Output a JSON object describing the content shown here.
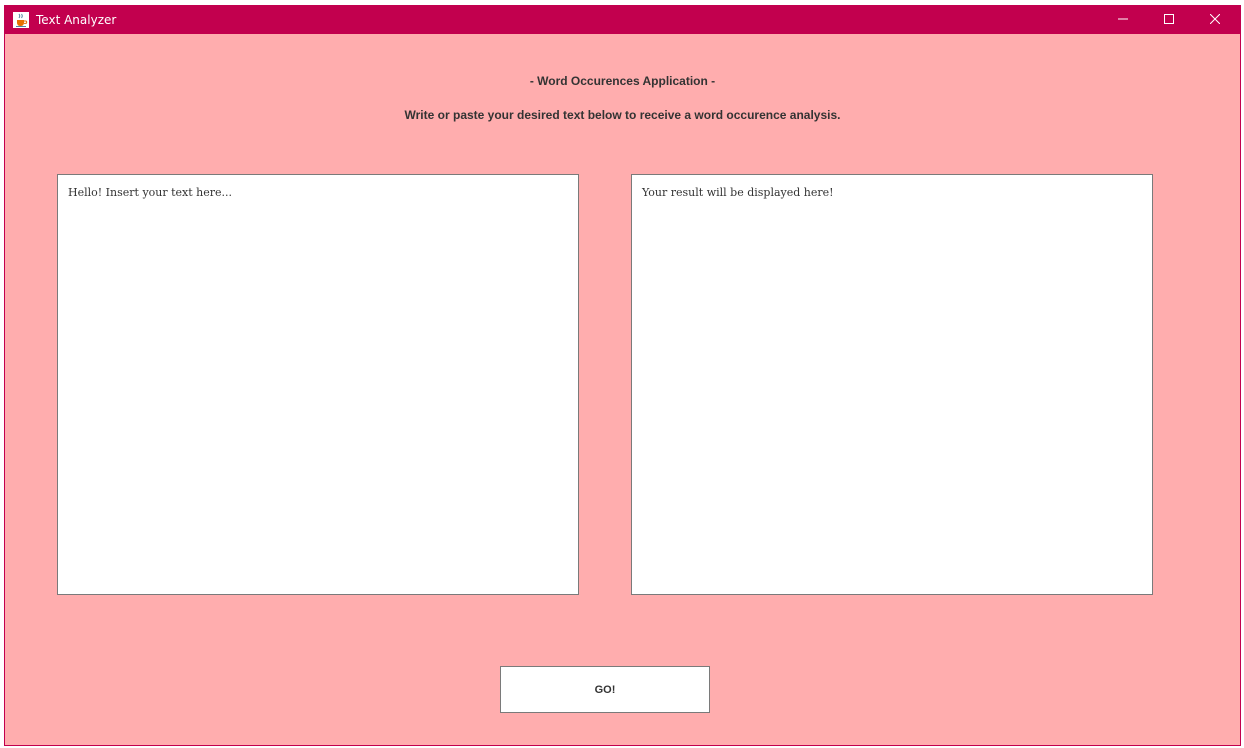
{
  "window": {
    "title": "Text Analyzer",
    "icon": "java-cup-icon",
    "controls": [
      "minimize-icon",
      "maximize-icon",
      "close-icon"
    ]
  },
  "header": {
    "title": "- Word Occurences Application -",
    "instructions": "Write or paste your desired text below to receive a word occurence analysis."
  },
  "input_area": {
    "value": "Hello! Insert your text here..."
  },
  "output_area": {
    "value": "Your result will be displayed here!"
  },
  "actions": {
    "go_label": "GO!"
  },
  "colors": {
    "titlebar": "#c2004e",
    "background": "#ffadae",
    "pane": "#ffffff"
  }
}
